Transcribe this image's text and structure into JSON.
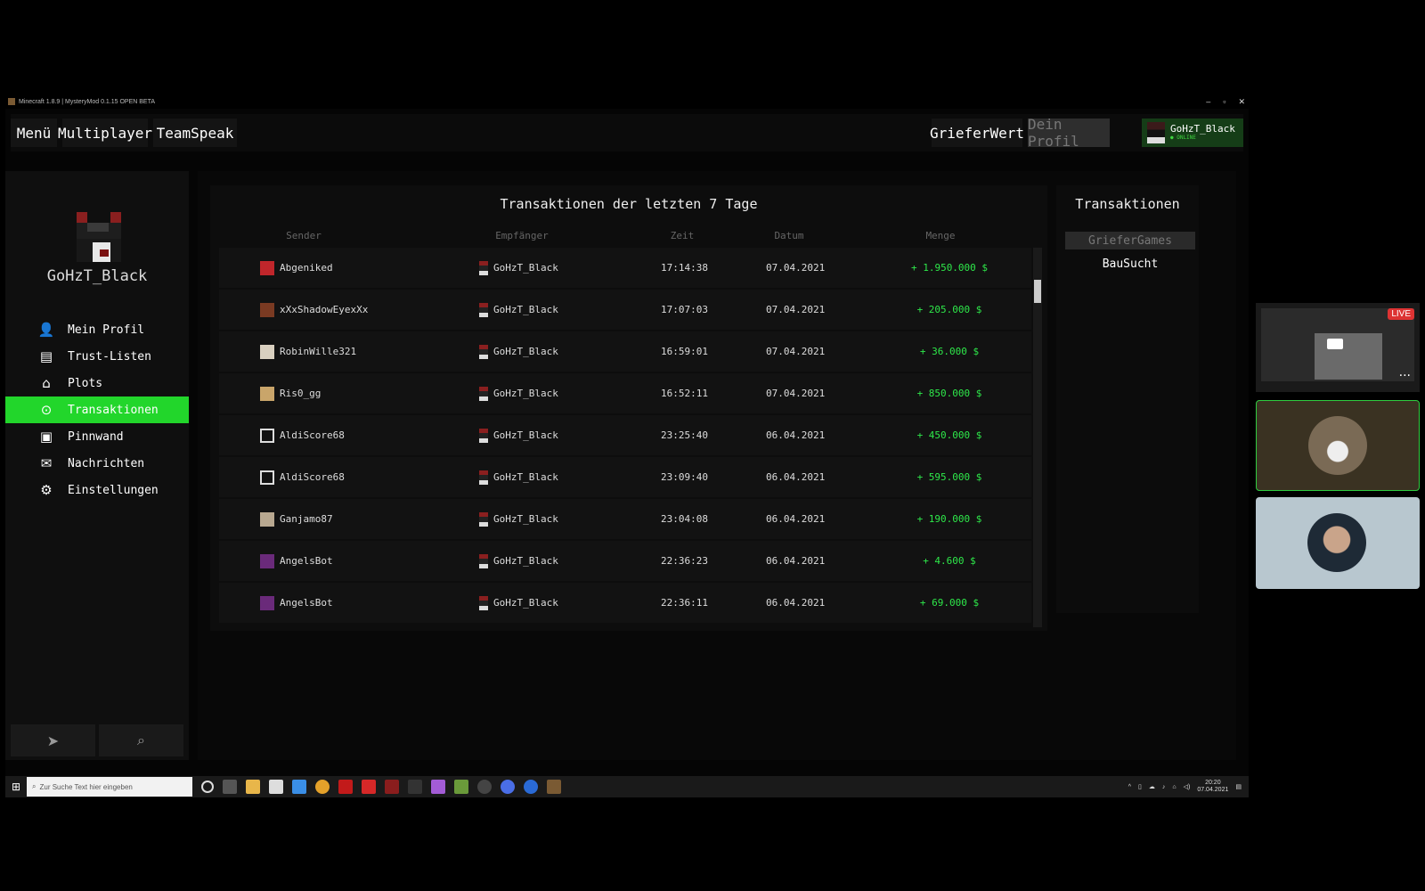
{
  "window": {
    "title": "Minecraft 1.8.9 | MysteryMod 0.1.15 OPEN BETA",
    "minimize": "–",
    "maximize": "▫",
    "close": "✕"
  },
  "topnav": {
    "menu": "Menü",
    "multiplayer": "Multiplayer",
    "teamspeak": "TeamSpeak",
    "grieferwert": "GrieferWert",
    "dein_profil": "Dein Profil",
    "user_name": "GoHzT_Black",
    "user_status": "● ONLINE"
  },
  "sidebar": {
    "player_name": "GoHzT_Black",
    "items": [
      {
        "label": "Mein Profil",
        "icon": "user-icon"
      },
      {
        "label": "Trust-Listen",
        "icon": "list-icon"
      },
      {
        "label": "Plots",
        "icon": "home-icon"
      },
      {
        "label": "Transaktionen",
        "icon": "transaction-icon"
      },
      {
        "label": "Pinnwand",
        "icon": "pinboard-icon"
      },
      {
        "label": "Nachrichten",
        "icon": "mail-icon"
      },
      {
        "label": "Einstellungen",
        "icon": "gear-icon"
      }
    ],
    "active_index": 3,
    "bottom": [
      "send-icon",
      "search-icon"
    ]
  },
  "panel": {
    "title": "Transaktionen der letzten 7 Tage",
    "columns": [
      "Sender",
      "Empfänger",
      "Zeit",
      "Datum",
      "Menge"
    ],
    "rows": [
      {
        "sender": "Abgeniked",
        "receiver": "GoHzT_Black",
        "time": "17:14:38",
        "date": "07.04.2021",
        "amount": "+ 1.950.000 $"
      },
      {
        "sender": "xXxShadowEyexXx",
        "receiver": "GoHzT_Black",
        "time": "17:07:03",
        "date": "07.04.2021",
        "amount": "+ 205.000 $"
      },
      {
        "sender": "RobinWille321",
        "receiver": "GoHzT_Black",
        "time": "16:59:01",
        "date": "07.04.2021",
        "amount": "+ 36.000 $"
      },
      {
        "sender": "Ris0_gg",
        "receiver": "GoHzT_Black",
        "time": "16:52:11",
        "date": "07.04.2021",
        "amount": "+ 850.000 $"
      },
      {
        "sender": "AldiScore68",
        "receiver": "GoHzT_Black",
        "time": "23:25:40",
        "date": "06.04.2021",
        "amount": "+ 450.000 $"
      },
      {
        "sender": "AldiScore68",
        "receiver": "GoHzT_Black",
        "time": "23:09:40",
        "date": "06.04.2021",
        "amount": "+ 595.000 $"
      },
      {
        "sender": "Ganjamo87",
        "receiver": "GoHzT_Black",
        "time": "23:04:08",
        "date": "06.04.2021",
        "amount": "+ 190.000 $"
      },
      {
        "sender": "AngelsBot",
        "receiver": "GoHzT_Black",
        "time": "22:36:23",
        "date": "06.04.2021",
        "amount": "+ 4.600 $"
      },
      {
        "sender": "AngelsBot",
        "receiver": "GoHzT_Black",
        "time": "22:36:11",
        "date": "06.04.2021",
        "amount": "+ 69.000 $"
      }
    ]
  },
  "rpanel": {
    "title": "Transaktionen",
    "options": [
      "GrieferGames",
      "BauSucht"
    ],
    "selected": 0
  },
  "taskbar": {
    "search_placeholder": "Zur Suche Text hier eingeben",
    "time": "20:20",
    "date": "07.04.2021"
  },
  "video": {
    "live": "LIVE",
    "more": "···"
  },
  "colors": {
    "accent": "#22d62b",
    "amount": "#2ee84a"
  }
}
